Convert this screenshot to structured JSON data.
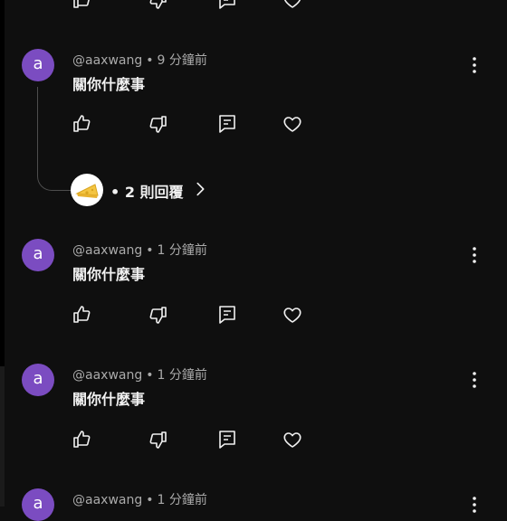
{
  "comments": [
    {
      "avatar_letter": "a",
      "author": "@aaxwang",
      "separator": "•",
      "time": "9 分鐘前",
      "text": "關你什麼事",
      "replies": {
        "dot": "•",
        "label": "2 則回覆"
      }
    },
    {
      "avatar_letter": "a",
      "author": "@aaxwang",
      "separator": "•",
      "time": "1 分鐘前",
      "text": "關你什麼事"
    },
    {
      "avatar_letter": "a",
      "author": "@aaxwang",
      "separator": "•",
      "time": "1 分鐘前",
      "text": "關你什麼事"
    },
    {
      "avatar_letter": "a",
      "author": "@aaxwang",
      "separator": "•",
      "time": "1 分鐘前",
      "text": ""
    }
  ],
  "icons": {
    "like": "thumbs-up-icon",
    "dislike": "thumbs-down-icon",
    "reply": "reply-icon",
    "heart": "heart-icon",
    "more": "more-vertical-icon",
    "chevron": "chevron-right-icon"
  },
  "colors": {
    "background": "#0f0f0f",
    "avatar": "#7b4cc1",
    "meta_text": "#aaaaaa",
    "text": "#f1f1f1"
  }
}
